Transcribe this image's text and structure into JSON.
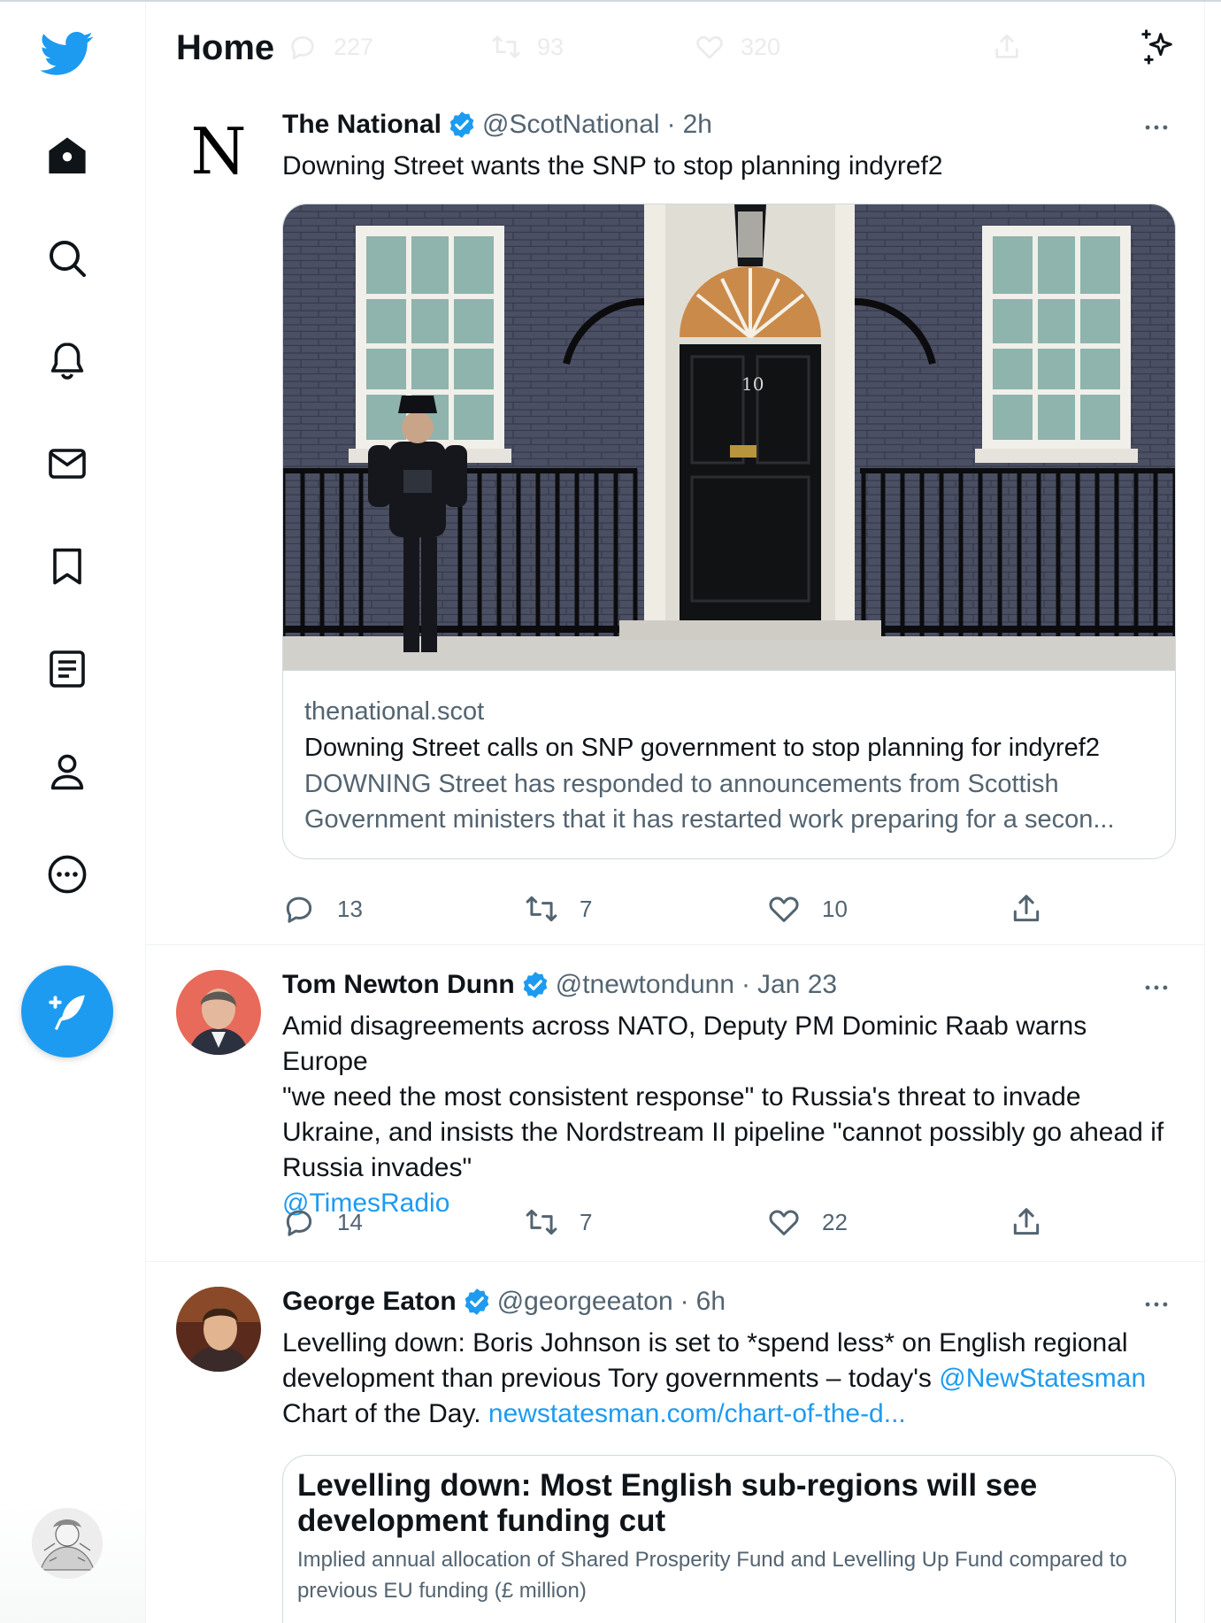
{
  "header": {
    "title": "Home",
    "ghost_actions": {
      "replies": "227",
      "retweets": "93",
      "likes": "320"
    }
  },
  "sidebar": {
    "items": [
      {
        "icon": "twitter-logo-icon"
      },
      {
        "icon": "home-icon"
      },
      {
        "icon": "explore-search-icon"
      },
      {
        "icon": "notifications-bell-icon"
      },
      {
        "icon": "messages-envelope-icon"
      },
      {
        "icon": "bookmarks-icon"
      },
      {
        "icon": "lists-icon"
      },
      {
        "icon": "profile-icon"
      },
      {
        "icon": "more-circle-icon"
      }
    ],
    "compose_icon": "compose-tweet-icon"
  },
  "tweets": [
    {
      "name": "The National",
      "handle": "@ScotNational",
      "separator": "·",
      "time": "2h",
      "text": "Downing Street wants the SNP to stop planning indyref2",
      "card": {
        "domain": "thenational.scot",
        "title": "Downing Street calls on SNP government to stop planning for indyref2",
        "description_line1": "DOWNING Street has responded to announcements from Scottish",
        "description_line2": "Government ministers that it has restarted work preparing for a secon..."
      },
      "replies": "13",
      "retweets": "7",
      "likes": "10"
    },
    {
      "name": "Tom Newton Dunn",
      "handle": "@tnewtondunn",
      "separator": "·",
      "time": "Jan 23",
      "text_lines": [
        "Amid disagreements across NATO, Deputy PM Dominic Raab warns Europe",
        "\"we need the most consistent response\" to Russia's threat to invade",
        "Ukraine, and insists the Nordstream II pipeline \"cannot possibly go ahead if",
        "Russia invades\""
      ],
      "mention": "@TimesRadio",
      "replies": "14",
      "retweets": "7",
      "likes": "22"
    },
    {
      "name": "George Eaton",
      "handle": "@georgeeaton",
      "separator": "·",
      "time": "6h",
      "text_line1": "Levelling down: Boris Johnson is set to *spend less* on English regional",
      "text_line2_a": "development than previous Tory governments – today's ",
      "text_line2_mention": "@NewStatesman",
      "text_line3_a": "Chart of the Day. ",
      "text_line3_link": "newstatesman.com/chart-of-the-d...",
      "card": {
        "title": "Levelling down: Most English sub-regions will see development funding cut",
        "subtitle": "Implied annual allocation of Shared Prosperity Fund and Levelling Up Fund compared to previous EU funding (£ million)"
      }
    }
  ],
  "colors": {
    "accent": "#1d9bf0",
    "text": "#0f1419",
    "secondary": "#536471",
    "border": "#cfd9de"
  }
}
